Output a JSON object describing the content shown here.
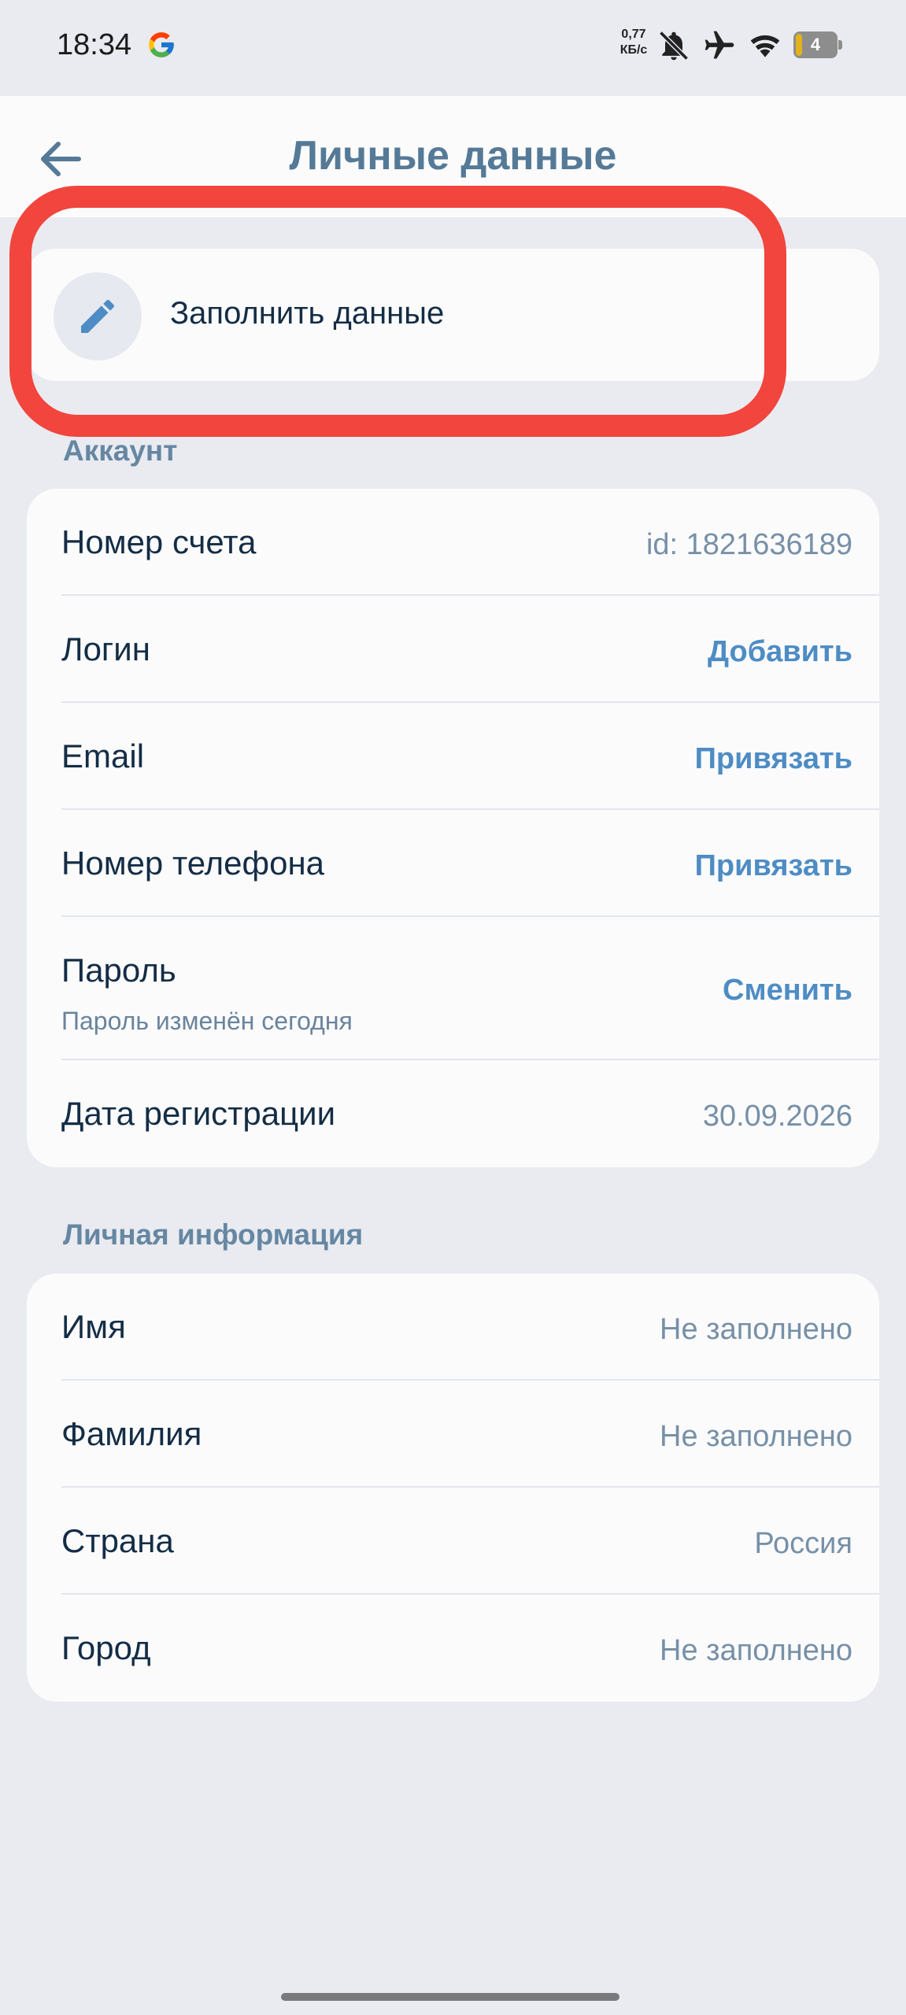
{
  "status_bar": {
    "time": "18:34",
    "net_speed_value": "0,77",
    "net_speed_unit": "КБ/с",
    "battery_level": "4"
  },
  "header": {
    "title": "Личные данные"
  },
  "fill_card": {
    "label": "Заполнить данные"
  },
  "account": {
    "section_title": "Аккаунт",
    "rows": [
      {
        "label": "Номер счета",
        "value": "id: 1821636189"
      },
      {
        "label": "Логин",
        "action": "Добавить"
      },
      {
        "label": "Email",
        "action": "Привязать"
      },
      {
        "label": "Номер телефона",
        "action": "Привязать"
      },
      {
        "label": "Пароль",
        "sublabel": "Пароль изменён сегодня",
        "action": "Сменить"
      },
      {
        "label": "Дата регистрации",
        "value": "30.09.2026"
      }
    ]
  },
  "personal": {
    "section_title": "Личная информация",
    "rows": [
      {
        "label": "Имя",
        "value": "Не заполнено"
      },
      {
        "label": "Фамилия",
        "value": "Не заполнено"
      },
      {
        "label": "Страна",
        "value": "Россия"
      },
      {
        "label": "Город",
        "value": "Не заполнено"
      }
    ]
  },
  "colors": {
    "background": "#e9ebf0",
    "card": "#fbfbfc",
    "title": "#557a97",
    "action": "#4e8cc4",
    "highlight": "#f1453d"
  },
  "icons": {
    "back": "arrow-left-icon",
    "pencil": "pencil-icon",
    "google": "google-g-icon",
    "mute": "bell-off-icon",
    "airplane": "airplane-icon",
    "wifi": "wifi-icon",
    "battery": "battery-icon"
  }
}
